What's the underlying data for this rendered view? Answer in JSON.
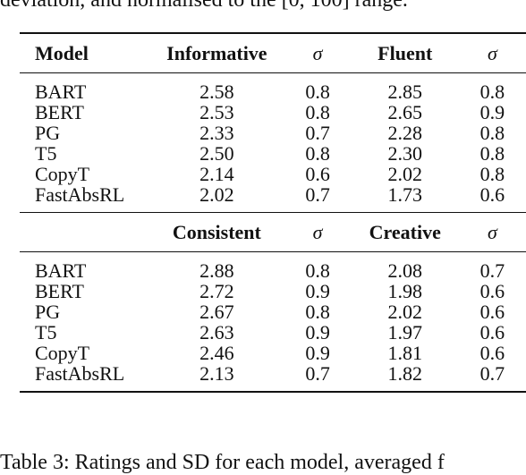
{
  "preceding_text": "deviation, and normalised to the [0, 100] range.",
  "table": {
    "sections": [
      {
        "headers": [
          "Model",
          "Informative",
          "σ",
          "Fluent",
          "σ"
        ],
        "rows": [
          [
            "BART",
            "2.58",
            "0.8",
            "2.85",
            "0.8"
          ],
          [
            "BERT",
            "2.53",
            "0.8",
            "2.65",
            "0.9"
          ],
          [
            "PG",
            "2.33",
            "0.7",
            "2.28",
            "0.8"
          ],
          [
            "T5",
            "2.50",
            "0.8",
            "2.30",
            "0.8"
          ],
          [
            "CopyT",
            "2.14",
            "0.6",
            "2.02",
            "0.8"
          ],
          [
            "FastAbsRL",
            "2.02",
            "0.7",
            "1.73",
            "0.6"
          ]
        ]
      },
      {
        "headers": [
          "",
          "Consistent",
          "σ",
          "Creative",
          "σ"
        ],
        "rows": [
          [
            "BART",
            "2.88",
            "0.8",
            "2.08",
            "0.7"
          ],
          [
            "BERT",
            "2.72",
            "0.9",
            "1.98",
            "0.6"
          ],
          [
            "PG",
            "2.67",
            "0.8",
            "2.02",
            "0.6"
          ],
          [
            "T5",
            "2.63",
            "0.9",
            "1.97",
            "0.6"
          ],
          [
            "CopyT",
            "2.46",
            "0.9",
            "1.81",
            "0.6"
          ],
          [
            "FastAbsRL",
            "2.13",
            "0.7",
            "1.82",
            "0.7"
          ]
        ]
      }
    ]
  },
  "caption": "Table 3: Ratings and SD for each model, averaged f"
}
